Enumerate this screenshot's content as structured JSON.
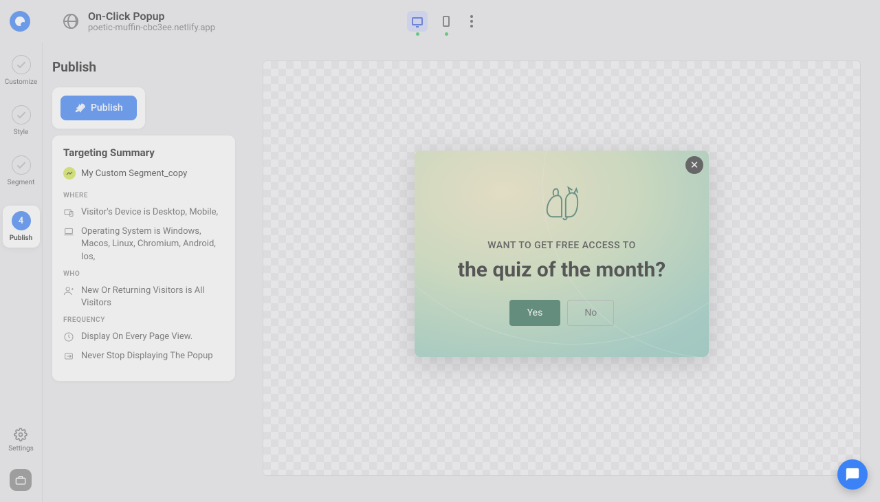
{
  "header": {
    "title": "On-Click Popup",
    "subtitle": "poetic-muffin-cbc3ee.netlify.app"
  },
  "sidebar": {
    "steps": [
      {
        "label": "Customize"
      },
      {
        "label": "Style"
      },
      {
        "label": "Segment"
      },
      {
        "number": "4",
        "label": "Publish"
      }
    ],
    "settings_label": "Settings"
  },
  "panel": {
    "title": "Publish",
    "publish_button": "Publish",
    "summary_title": "Targeting Summary",
    "segment_name": "My Custom Segment_copy",
    "sections": {
      "where_label": "WHERE",
      "where_rules": [
        "Visitor's Device is Desktop, Mobile,",
        "Operating System is Windows, Macos, Linux, Chromium, Android, Ios,"
      ],
      "who_label": "WHO",
      "who_rules": [
        "New Or Returning Visitors is All Visitors"
      ],
      "frequency_label": "FREQUENCY",
      "frequency_rules": [
        "Display On Every Page View.",
        "Never Stop Displaying The Popup"
      ]
    }
  },
  "preview_popup": {
    "pretitle": "WANT TO GET FREE ACCESS TO",
    "title": "the quiz of the month?",
    "yes_label": "Yes",
    "no_label": "No"
  }
}
